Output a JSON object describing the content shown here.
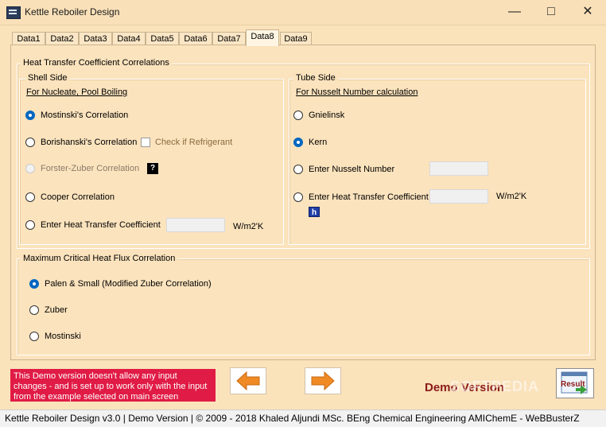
{
  "window": {
    "title": "Kettle Reboiler Design"
  },
  "tabs": [
    "Data1",
    "Data2",
    "Data3",
    "Data4",
    "Data5",
    "Data6",
    "Data7",
    "Data8",
    "Data9"
  ],
  "main": {
    "htc_group_title": "Heat Transfer Coefficient Correlations",
    "shell": {
      "title": "Shell Side",
      "link": "For Nucleate, Pool Boiling",
      "options": [
        "Mostinski's Correlation",
        "Borishanski's Correlation",
        "Forster-Zuber Correlation",
        "Cooper Correlation",
        "Enter Heat Transfer Coefficient"
      ],
      "refrigerant_label": "Check if Refrigerant",
      "help_glyph": "?",
      "unit": "W/m2'K"
    },
    "tube": {
      "title": "Tube Side",
      "link": "For Nusselt Number calculation",
      "options": [
        "Gnielinsk",
        "Kern",
        "Enter Nusselt Number",
        "Enter Heat Transfer Coefficient"
      ],
      "unit": "W/m2'K",
      "h_glyph": "h"
    },
    "chf": {
      "title": "Maximum Critical Heat Flux Correlation",
      "options": [
        "Palen & Small (Modified Zuber Correlation)",
        "Zuber",
        "Mostinski"
      ]
    }
  },
  "footer": {
    "demo_note": "This Demo version doesn't allow any input changes - and is set up to work only with the input from the example selected on main screen",
    "demo_version": "Demo Version",
    "watermark": "SOFTPEDIA",
    "result_label": "Result"
  },
  "status": {
    "text": "Kettle Reboiler Design  v3.0  |  Demo Version  |  © 2009 - 2018 Khaled Aljundi MSc. BEng Chemical Engineering AMIChemE - WeBBusterZ"
  },
  "colors": {
    "accent": "#0067c0",
    "demo_red": "#e01b45",
    "demo_text": "#8b1a1a",
    "arrow": "#f08a24",
    "panel": "#fbe3bd"
  }
}
